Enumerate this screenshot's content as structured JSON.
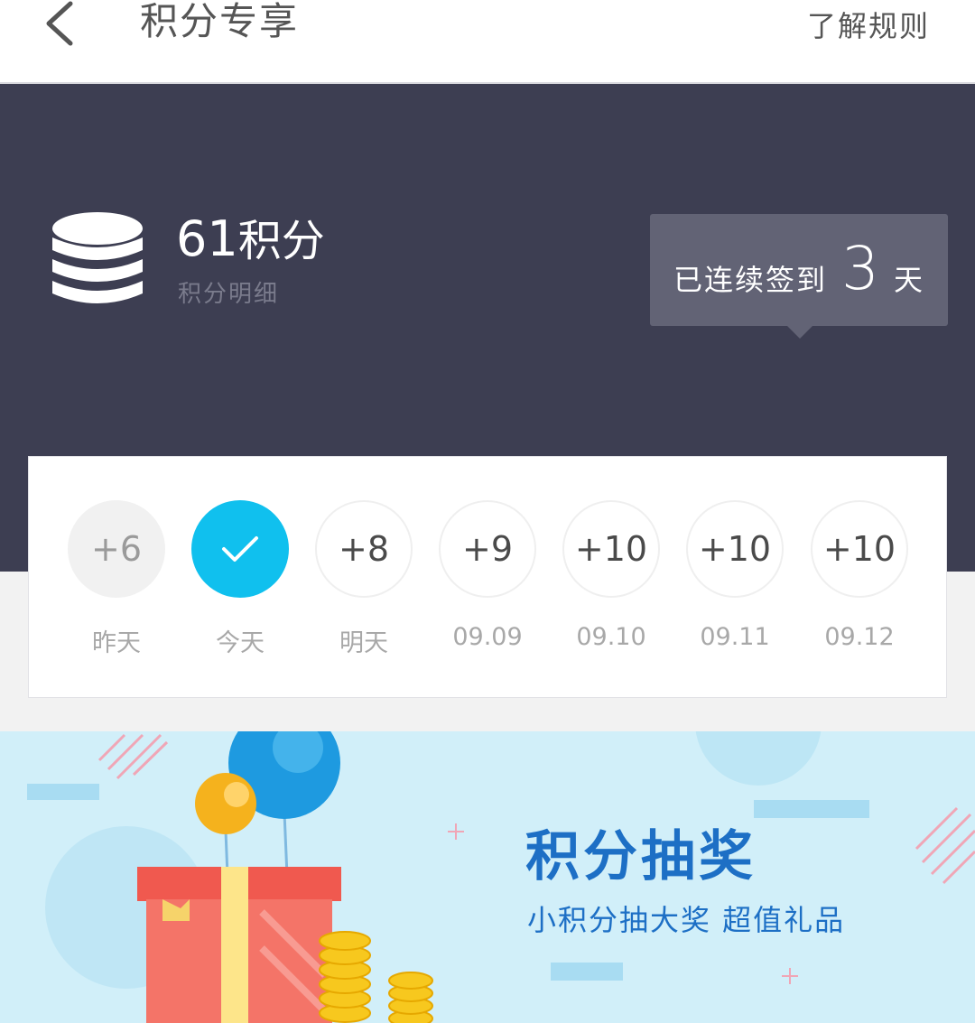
{
  "header": {
    "title": "积分专享",
    "rules_label": "了解规则",
    "back_icon": "chevron-left-icon"
  },
  "points": {
    "value": "61",
    "unit": "积分",
    "detail_label": "积分明细",
    "icon": "coin-stack-icon"
  },
  "streak": {
    "prefix": "已连续签到",
    "days": "3",
    "suffix": "天"
  },
  "checkin": {
    "days": [
      {
        "reward": "+6",
        "label": "昨天",
        "state": "past"
      },
      {
        "reward": "",
        "label": "今天",
        "state": "today-checked"
      },
      {
        "reward": "+8",
        "label": "明天",
        "state": "future"
      },
      {
        "reward": "+9",
        "label": "09.09",
        "state": "future"
      },
      {
        "reward": "+10",
        "label": "09.10",
        "state": "future"
      },
      {
        "reward": "+10",
        "label": "09.11",
        "state": "future"
      },
      {
        "reward": "+10",
        "label": "09.12",
        "state": "future"
      }
    ]
  },
  "banner": {
    "title": "积分抽奖",
    "subtitle": "小积分抽大奖 超值礼品"
  },
  "colors": {
    "hero_bg": "#3d3e52",
    "accent": "#10c0ee",
    "banner_bg": "#d1eff9",
    "banner_text": "#1d6fc5"
  }
}
